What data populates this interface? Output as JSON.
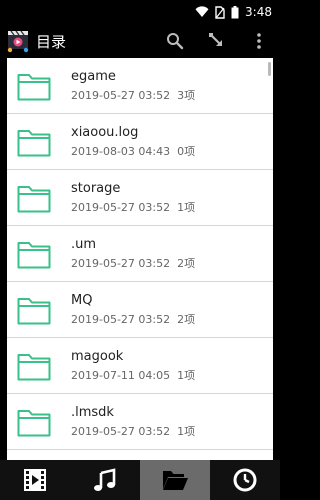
{
  "status_bar": {
    "time": "3:48",
    "icons": [
      "wifi-icon",
      "no-sim-icon",
      "battery-icon"
    ]
  },
  "app_bar": {
    "title": "目录",
    "logo_icon": "app-logo-icon",
    "actions": [
      "search-icon",
      "download-icon",
      "more-vert-icon"
    ]
  },
  "files": [
    {
      "name": "egame",
      "modified": "2019-05-27 03:52",
      "count": "3项"
    },
    {
      "name": "xiaoou.log",
      "modified": "2019-08-03 04:43",
      "count": "0项"
    },
    {
      "name": "storage",
      "modified": "2019-05-27 03:52",
      "count": "1项"
    },
    {
      "name": ".um",
      "modified": "2019-05-27 03:52",
      "count": "2项"
    },
    {
      "name": "MQ",
      "modified": "2019-05-27 03:52",
      "count": "2项"
    },
    {
      "name": "magook",
      "modified": "2019-07-11 04:05",
      "count": "1项"
    },
    {
      "name": ".lmsdk",
      "modified": "2019-05-27 03:52",
      "count": "1项"
    }
  ],
  "bottom_nav": {
    "tabs": [
      {
        "icon": "video-icon",
        "active": false
      },
      {
        "icon": "music-icon",
        "active": false
      },
      {
        "icon": "folder-open-icon",
        "active": true
      },
      {
        "icon": "clock-icon",
        "active": false
      }
    ]
  },
  "colors": {
    "folder_outline": "#3ac08a",
    "active_tab": "#6b6b6b"
  }
}
